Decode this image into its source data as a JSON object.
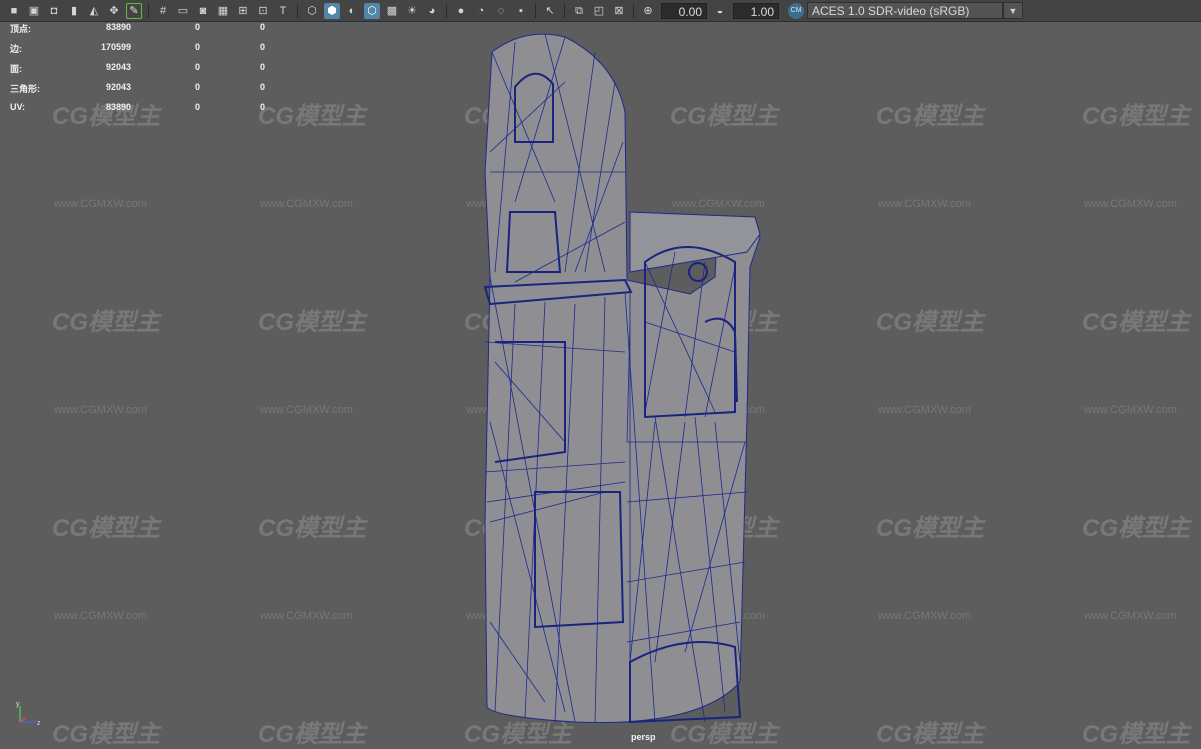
{
  "toolbar": {
    "icons": [
      "camera-icon",
      "camera-attributes-icon",
      "camera-lock-icon",
      "bookmark-icon",
      "image-plane-icon",
      "pan-zoom-icon",
      "grease-pencil-icon",
      "grid-icon",
      "film-gate-icon",
      "resolution-gate-icon",
      "gate-mask-icon",
      "field-chart-icon",
      "safe-title-icon",
      "wireframe-icon",
      "smooth-shade-icon",
      "default-material-icon",
      "shade-wireframe-icon",
      "textured-icon",
      "lighting-icon",
      "shadows-icon",
      "screen-space-ao-icon",
      "motion-blur-icon",
      "antialiasing-icon",
      "depth-of-field-icon",
      "isolate-select-icon",
      "xray-icon",
      "xray-joints-icon",
      "backface-culling-icon",
      "exposure-icon",
      "gamma-icon"
    ],
    "exposure": "0.00",
    "gamma": "1.00",
    "color_space": "ACES 1.0 SDR-video (sRGB)"
  },
  "hud": {
    "rows": [
      {
        "label": "顶点:",
        "v1": "83890",
        "v2": "0",
        "v3": "0"
      },
      {
        "label": "边:",
        "v1": "170599",
        "v2": "0",
        "v3": "0"
      },
      {
        "label": "面:",
        "v1": "92043",
        "v2": "0",
        "v3": "0"
      },
      {
        "label": "三角形:",
        "v1": "92043",
        "v2": "0",
        "v3": "0"
      },
      {
        "label": "UV:",
        "v1": "83890",
        "v2": "0",
        "v3": "0"
      }
    ]
  },
  "viewport": {
    "camera_label": "persp"
  },
  "watermark": {
    "logo": "CG模型主",
    "url": "www.CGMXW.com"
  },
  "colors": {
    "background": "#5d5d5d",
    "wireframe": "#1f2a8a",
    "model_fill": "#8f8f94",
    "toolbar": "#444444",
    "active_icon": "#5285a6"
  }
}
